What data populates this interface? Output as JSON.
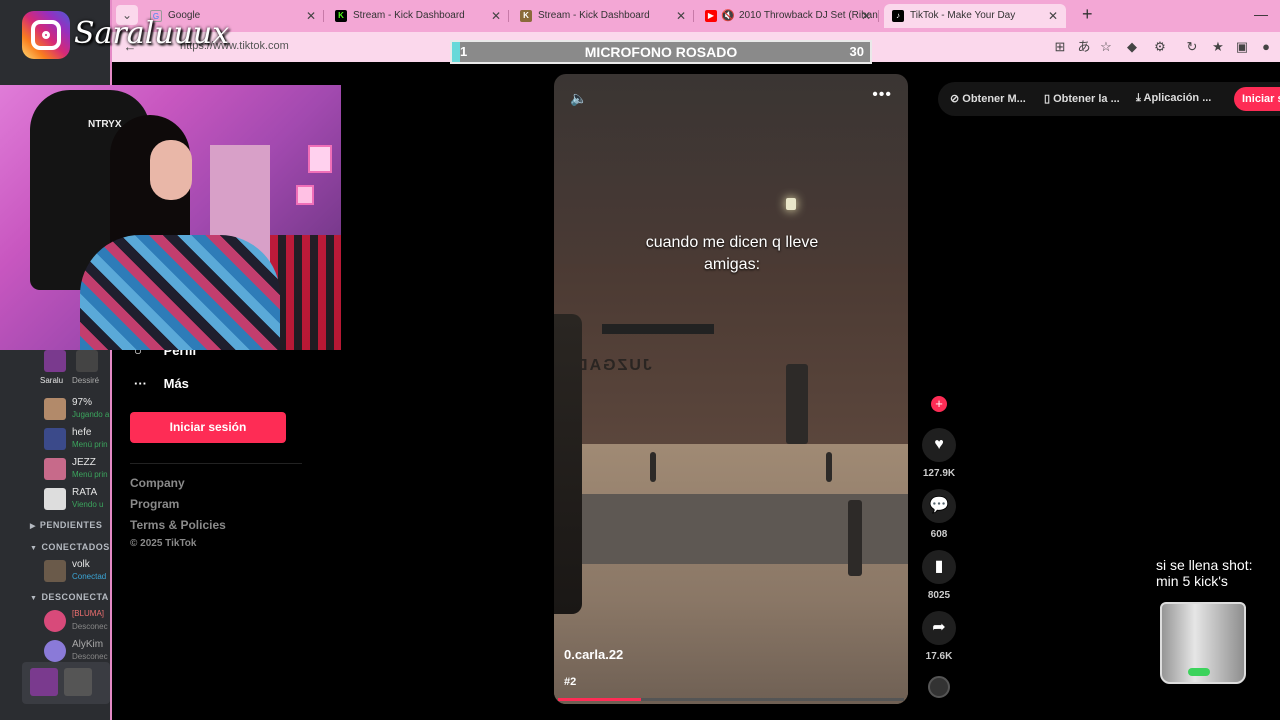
{
  "browser": {
    "tabs": [
      {
        "title": "Google",
        "favicon": "google-icon",
        "color": "#fbd8ec"
      },
      {
        "title": "Stream - Kick Dashboard",
        "favicon": "kick-icon",
        "color": "#53fc18"
      },
      {
        "title": "Stream - Kick Dashboard",
        "favicon": "kick-icon",
        "color": "#8a6a3a"
      },
      {
        "title": "2010 Throwback DJ Set (Rihan",
        "favicon": "youtube-icon",
        "color": "#ff0000"
      },
      {
        "title": "TikTok - Make Your Day",
        "favicon": "tiktok-icon",
        "color": "#000000"
      }
    ],
    "url": "https://www.tiktok.com"
  },
  "tiktok": {
    "sidebar": {
      "profile_label": "Perfil",
      "more_label": "Más",
      "login_button": "Iniciar sesión",
      "footer": {
        "company": "Company",
        "program": "Program",
        "terms": "Terms & Policies",
        "copyright": "© 2025 TikTok"
      }
    },
    "top_actions": {
      "get_coins": "Obtener M...",
      "get_app": "Obtener la ...",
      "desktop_app": "Aplicación ...",
      "login": "Iniciar s"
    },
    "video": {
      "caption_line1": "cuando me dicen q lleve",
      "caption_line2": "amigas:",
      "sign_text": "JUZGAD",
      "username": "0.carla.22",
      "hashtag": "#2",
      "progress": 0.24
    },
    "actions": {
      "likes": "127.9K",
      "comments": "608",
      "saves": "8025",
      "shares": "17.6K"
    }
  },
  "overlay": {
    "instagram_handle": "Saraluuux",
    "mic_bar": {
      "left": "1",
      "title": "MICROFONO ROSADO",
      "right": "30",
      "fill": 0.02
    },
    "shot_line1": "si se llena shot:",
    "shot_line2": "min 5 kick's",
    "webcam_chair_text": "NTRYX"
  },
  "discord": {
    "friends": [
      {
        "name": "Saralu",
        "status": ""
      },
      {
        "name": "Dessiré",
        "status": ""
      },
      {
        "name": "97%",
        "status": "Jugando a"
      },
      {
        "name": "hefe",
        "status": "Menú prin"
      },
      {
        "name": "JEZZ",
        "status": "Menú prin"
      },
      {
        "name": "RATA",
        "status": "Viendo u"
      }
    ],
    "sections": {
      "pending": "PENDIENTES",
      "connected": "CONECTADOS",
      "disconnected": "DESCONECTA"
    },
    "connected_user": {
      "name": "volk",
      "status": "Conectad"
    },
    "disconnected_users": [
      {
        "name": "[BLUMA]",
        "status": "Desconec"
      },
      {
        "name": "AlyKim",
        "status": "Desconec"
      }
    ]
  }
}
